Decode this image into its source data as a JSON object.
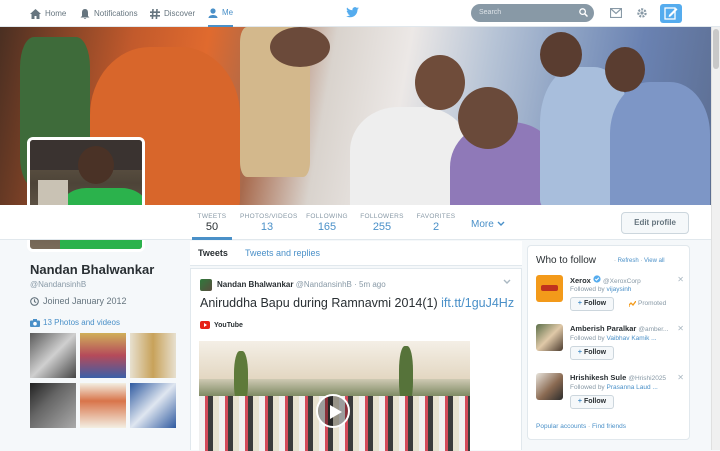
{
  "nav": {
    "home": "Home",
    "notifications": "Notifications",
    "discover": "Discover",
    "me": "Me",
    "search_placeholder": "Search"
  },
  "stats": [
    {
      "label": "TWEETS",
      "value": "50"
    },
    {
      "label": "PHOTOS/VIDEOS",
      "value": "13"
    },
    {
      "label": "FOLLOWING",
      "value": "165"
    },
    {
      "label": "FOLLOWERS",
      "value": "255"
    },
    {
      "label": "FAVORITES",
      "value": "2"
    }
  ],
  "more_label": "More",
  "edit_profile_label": "Edit profile",
  "profile": {
    "name": "Nandan Bhalwankar",
    "handle": "@NandansinhB",
    "joined": "Joined January 2012",
    "photos_videos": "13 Photos and videos"
  },
  "tabs": {
    "tweets": "Tweets",
    "tweets_replies": "Tweets and replies"
  },
  "tweet": {
    "author_name": "Nandan Bhalwankar",
    "author_handle": "@NandansinhB",
    "separator": "·",
    "time": "5m ago",
    "text": "Aniruddha Bapu during Ramnavmi 2014(1)",
    "link": "ift.tt/1guJ4Hz",
    "source": "YouTube"
  },
  "who_to_follow": {
    "title": "Who to follow",
    "refresh": "Refresh",
    "view_all": "View all",
    "suggestions": [
      {
        "name": "Xerox",
        "handle": "@XeroxCorp",
        "followed_by_prefix": "Followed by",
        "followed_by": "vijaysinh",
        "follow_label": "Follow",
        "promoted": "Promoted"
      },
      {
        "name": "Amberish Paralkar",
        "handle": "@amber...",
        "followed_by_prefix": "Followed by",
        "followed_by": "Vaibhav Kamik ...",
        "follow_label": "Follow",
        "promoted": ""
      },
      {
        "name": "Hrishikesh Sule",
        "handle": "@Hrishi2025",
        "followed_by_prefix": "Followed by",
        "followed_by": "Prasanna Laud ...",
        "follow_label": "Follow",
        "promoted": ""
      }
    ],
    "popular_accounts": "Popular accounts",
    "find_friends": "Find friends"
  },
  "colors": {
    "accent": "#4a90c8",
    "twitter_blue": "#55acee",
    "background": "#f5f8fa"
  }
}
